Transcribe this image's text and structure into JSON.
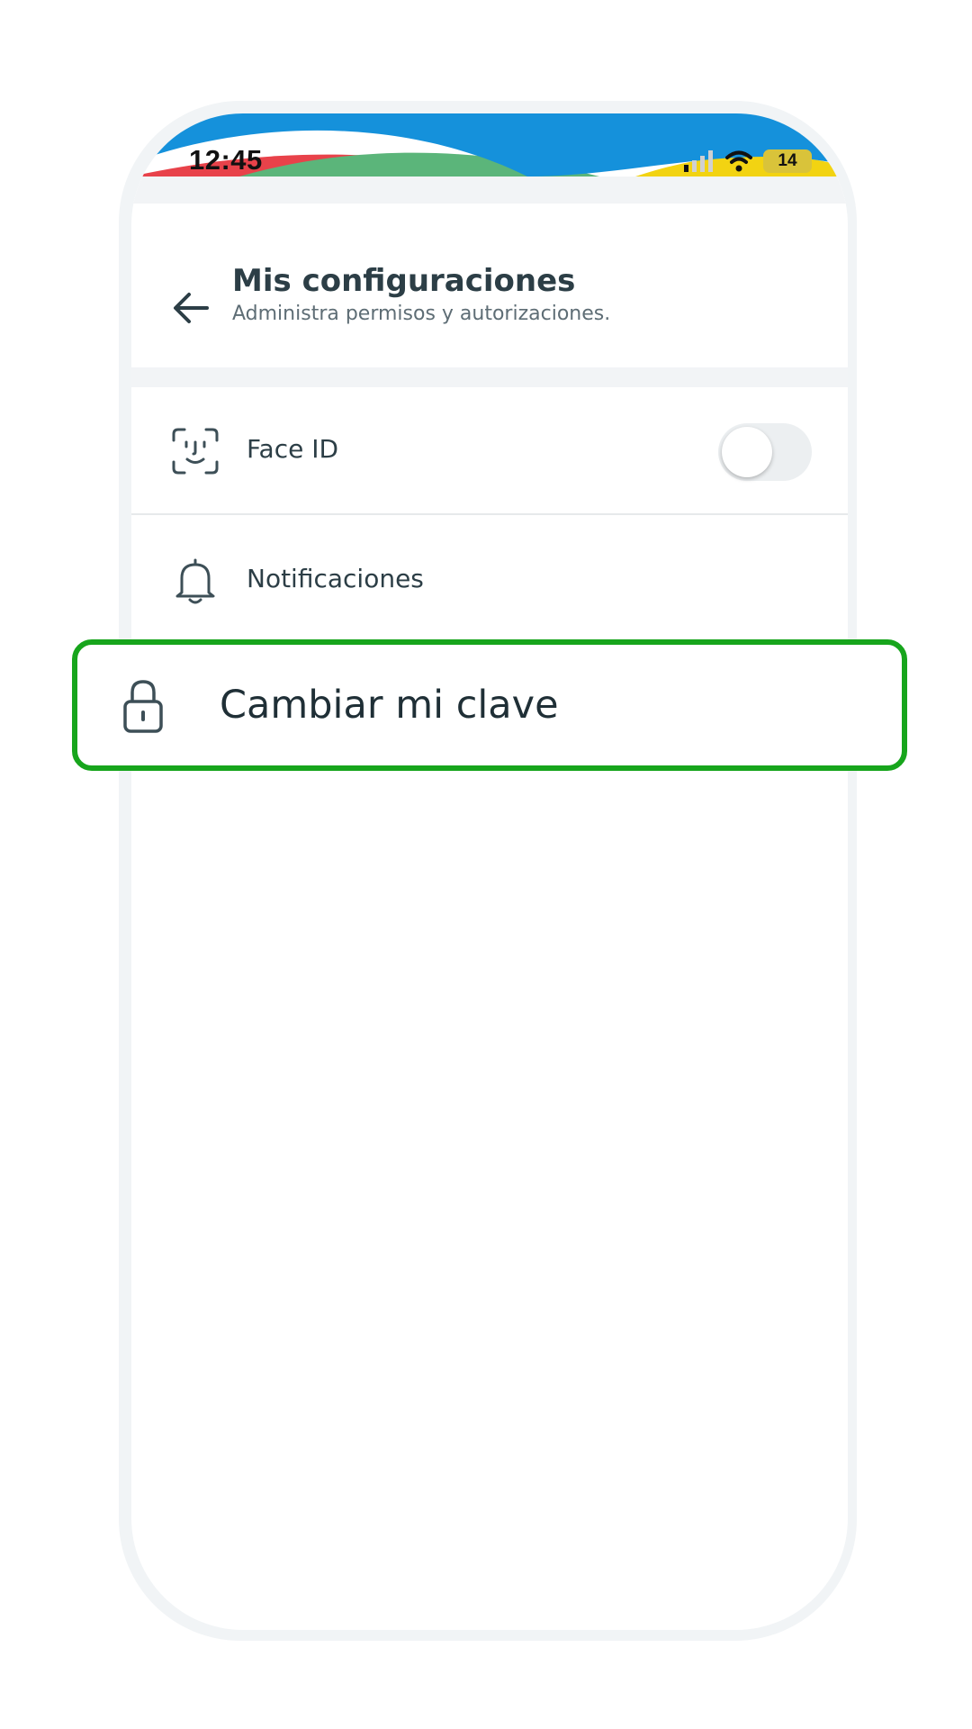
{
  "status_bar": {
    "time": "12:45",
    "battery": "14",
    "icons": [
      "signal-icon",
      "wifi-icon",
      "battery-icon"
    ]
  },
  "header": {
    "title": "Mis configuraciones",
    "subtitle": "Administra permisos y autorizaciones.",
    "back_icon": "back-arrow-icon"
  },
  "settings": {
    "items": [
      {
        "label": "Face ID",
        "icon": "face-id-icon",
        "toggle": false
      },
      {
        "label": "Notificaciones",
        "icon": "bell-icon"
      }
    ]
  },
  "highlight": {
    "label": "Cambiar mi clave",
    "icon": "lock-icon",
    "border_color": "#17a51c"
  },
  "colors": {
    "header_blue": "#1591db",
    "accent_red": "#e8424a",
    "accent_green": "#5bb57a",
    "accent_yellow": "#f2d312",
    "text_primary": "#2c3e46",
    "text_secondary": "#5e6d75"
  }
}
